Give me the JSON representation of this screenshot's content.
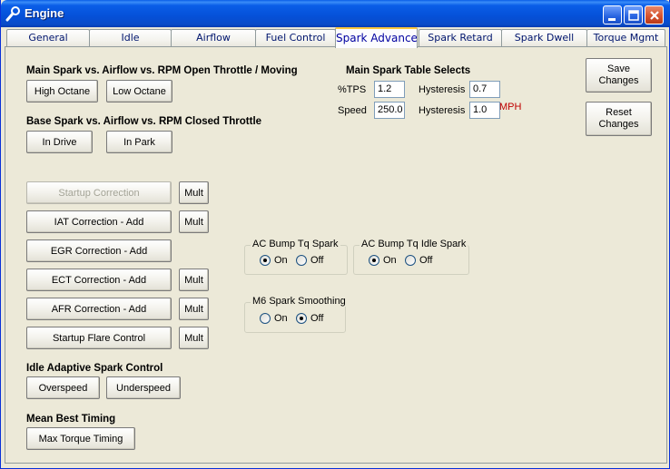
{
  "window": {
    "title": "Engine"
  },
  "tabs": [
    {
      "label": "General",
      "active": false
    },
    {
      "label": "Idle",
      "active": false
    },
    {
      "label": "Airflow",
      "active": false
    },
    {
      "label": "Fuel Control",
      "active": false
    },
    {
      "label": "Spark Advance",
      "active": true
    },
    {
      "label": "Spark Retard",
      "active": false
    },
    {
      "label": "Spark Dwell",
      "active": false
    },
    {
      "label": "Torque Mgmt",
      "active": false
    }
  ],
  "main_spark": {
    "heading": "Main Spark vs. Airflow vs. RPM Open Throttle / Moving",
    "high_octane": "High Octane",
    "low_octane": "Low Octane"
  },
  "base_spark": {
    "heading": "Base Spark vs. Airflow vs. RPM Closed Throttle",
    "in_drive": "In Drive",
    "in_park": "In Park"
  },
  "table_selects": {
    "heading": "Main Spark Table Selects",
    "tps_label": "%TPS",
    "tps_value": "1.2",
    "tps_hyst_label": "Hysteresis",
    "tps_hyst_value": "0.7",
    "speed_label": "Speed",
    "speed_value": "250.0",
    "speed_hyst_label": "Hysteresis",
    "speed_hyst_value": "1.0",
    "speed_unit": "MPH"
  },
  "actions": {
    "save": "Save Changes",
    "reset": "Reset Changes"
  },
  "corrections": {
    "startup": "Startup Correction",
    "iat": "IAT Correction - Add",
    "egr": "EGR Correction - Add",
    "ect": "ECT Correction - Add",
    "afr": "AFR Correction - Add",
    "flare": "Startup Flare Control",
    "mult": "Mult"
  },
  "ac_bump_spark": {
    "title": "AC Bump Tq Spark",
    "on": "On",
    "off": "Off",
    "selected": "On"
  },
  "ac_bump_idle_spark": {
    "title": "AC Bump Tq Idle Spark",
    "on": "On",
    "off": "Off",
    "selected": "On"
  },
  "m6_smoothing": {
    "title": "M6 Spark Smoothing",
    "on": "On",
    "off": "Off",
    "selected": "Off"
  },
  "idle_adaptive": {
    "heading": "Idle Adaptive Spark Control",
    "overspeed": "Overspeed",
    "underspeed": "Underspeed"
  },
  "mbt": {
    "heading": "Mean Best Timing",
    "max_torque": "Max Torque Timing"
  },
  "icons": {
    "title_icon": "wrench-icon",
    "minimize": "minimize-icon",
    "maximize": "maximize-icon",
    "close": "close-icon"
  }
}
